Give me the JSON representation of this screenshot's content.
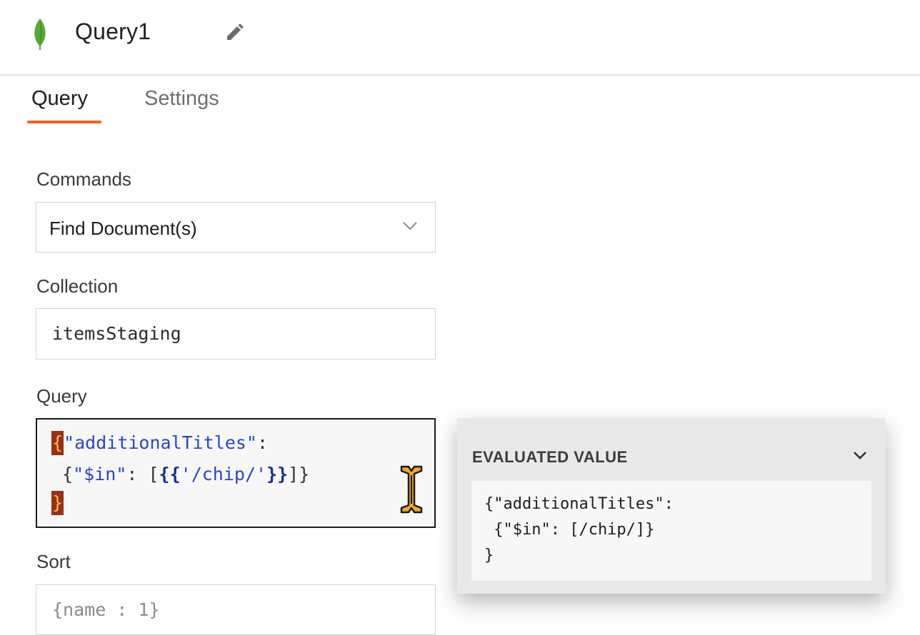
{
  "header": {
    "title": "Query1",
    "logo_icon": "mongodb-leaf-icon",
    "edit_icon": "pencil-icon"
  },
  "tabs": [
    {
      "label": "Query",
      "active": true
    },
    {
      "label": "Settings",
      "active": false
    }
  ],
  "form": {
    "commands": {
      "label": "Commands",
      "value": "Find Document(s)"
    },
    "collection": {
      "label": "Collection",
      "value": "itemsStaging"
    },
    "query": {
      "label": "Query",
      "line1_brace": "{",
      "line1_key": "\"additionalTitles\"",
      "line1_colon": ":",
      "line2_open": " {",
      "line2_key": "\"$in\"",
      "line2_mid": ": [",
      "line2_bind_open": "{{",
      "line2_str": "'/chip/'",
      "line2_bind_close": "}}",
      "line2_close": "]}",
      "line3_brace": "}"
    },
    "sort": {
      "label": "Sort",
      "placeholder": "{name : 1}"
    }
  },
  "evaluated": {
    "title": "EVALUATED VALUE",
    "lines": [
      "{\"additionalTitles\":",
      " {\"$in\": [/chip/]}",
      "}"
    ]
  },
  "colors": {
    "accent": "#e8622a",
    "logo_green": "#5aa834",
    "string_blue": "#2a46c9",
    "brace_highlight": "#9a2f1c"
  }
}
